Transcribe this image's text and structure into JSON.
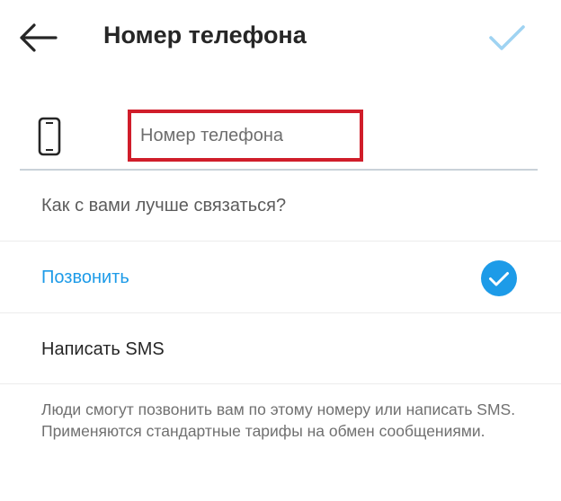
{
  "header": {
    "back_icon": "arrow-left-icon",
    "title": "Номер телефона",
    "confirm_icon": "checkmark-icon",
    "confirm_color": "#9fd3f2"
  },
  "phone": {
    "icon": "smartphone-icon",
    "placeholder": "Номер телефона",
    "value": "",
    "highlight_color": "#d01d2a"
  },
  "contact": {
    "question": "Как с вами лучше связаться?",
    "options": [
      {
        "label": "Позвонить",
        "selected": true
      },
      {
        "label": "Написать SMS",
        "selected": false
      }
    ],
    "accent": "#1d9be8"
  },
  "footnote": "Люди смогут позвонить вам по этому номеру или написать SMS. Применяются стандартные тарифы на обмен сообщениями."
}
